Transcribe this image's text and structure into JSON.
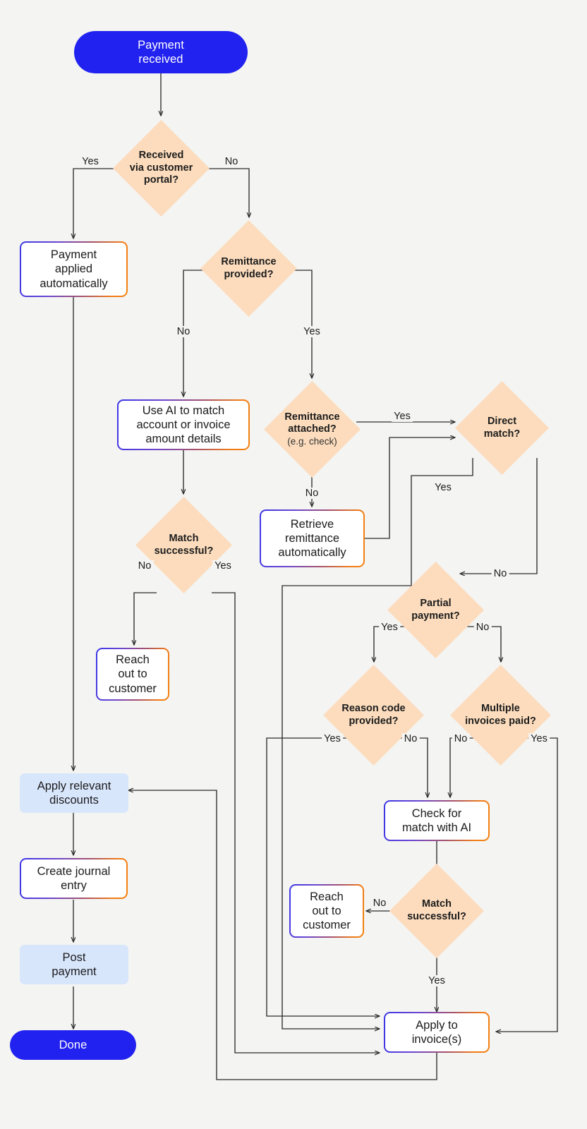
{
  "diagram": {
    "title": "Payment reconciliation flowchart",
    "background_color": "#f4f4f2",
    "colors": {
      "terminator_fill": "#2222f0",
      "terminator_text": "#ffffff",
      "decision_fill": "#fcdcbd",
      "process_fill": "#ffffff",
      "process_border_start": "#3b36e8",
      "process_border_end": "#f4820e",
      "highlight_fill": "#d8e6fc",
      "line": "#2b2b2b",
      "text": "#1c1c1c"
    }
  },
  "nodes": {
    "start": {
      "label": "Payment\nreceived",
      "line1": "Payment",
      "line2": "received",
      "type": "terminator"
    },
    "d_portal": {
      "line1": "Received",
      "line2": "via customer",
      "line3": "portal?",
      "type": "decision"
    },
    "payment_applied": {
      "line1": "Payment",
      "line2": "applied",
      "line3": "automatically",
      "type": "process"
    },
    "d_remit_provided": {
      "line1": "Remittance",
      "line2": "provided?",
      "type": "decision"
    },
    "use_ai_match": {
      "line1": "Use AI to match",
      "line2": "account or invoice",
      "line3": "amount details",
      "type": "process"
    },
    "d_remit_attached": {
      "line1": "Remittance",
      "line2": "attached?",
      "sub": "(e.g. check)",
      "type": "decision"
    },
    "d_direct_match": {
      "line1": "Direct",
      "line2": "match?",
      "type": "decision"
    },
    "retrieve_remittance": {
      "line1": "Retrieve",
      "line2": "remittance",
      "line3": "automatically",
      "type": "process"
    },
    "d_match_left": {
      "line1": "Match",
      "line2": "successful?",
      "type": "decision"
    },
    "reach_out_left": {
      "line1": "Reach",
      "line2": "out to",
      "line3": "customer",
      "type": "process"
    },
    "d_partial": {
      "line1": "Partial",
      "line2": "payment?",
      "type": "decision"
    },
    "d_reason_code": {
      "line1": "Reason code",
      "line2": "provided?",
      "type": "decision"
    },
    "d_multiple_invoices": {
      "line1": "Multiple",
      "line2": "invoices paid?",
      "type": "decision"
    },
    "apply_discounts": {
      "line1": "Apply relevant",
      "line2": "discounts",
      "type": "highlight"
    },
    "create_journal": {
      "line1": "Create journal",
      "line2": "entry",
      "type": "process"
    },
    "post_payment": {
      "line1": "Post",
      "line2": "payment",
      "type": "highlight"
    },
    "done": {
      "line1": "Done",
      "type": "terminator"
    },
    "check_ai": {
      "line1": "Check for",
      "line2": "match with AI",
      "type": "process"
    },
    "d_match_right": {
      "line1": "Match",
      "line2": "successful?",
      "type": "decision"
    },
    "reach_out_right": {
      "line1": "Reach",
      "line2": "out to",
      "line3": "customer",
      "type": "process"
    },
    "apply_invoices": {
      "line1": "Apply to",
      "line2": "invoice(s)",
      "type": "process"
    }
  },
  "edge_labels": {
    "portal_yes": "Yes",
    "portal_no": "No",
    "remit_provided_no": "No",
    "remit_provided_yes": "Yes",
    "remit_attached_yes": "Yes",
    "remit_attached_no": "No",
    "direct_match_yes": "Yes",
    "direct_match_no": "No",
    "match_left_no": "No",
    "match_left_yes": "Yes",
    "partial_yes": "Yes",
    "partial_no": "No",
    "reason_yes": "Yes",
    "reason_no": "No",
    "multiple_no": "No",
    "multiple_yes": "Yes",
    "match_right_no": "No",
    "match_right_yes": "Yes"
  }
}
